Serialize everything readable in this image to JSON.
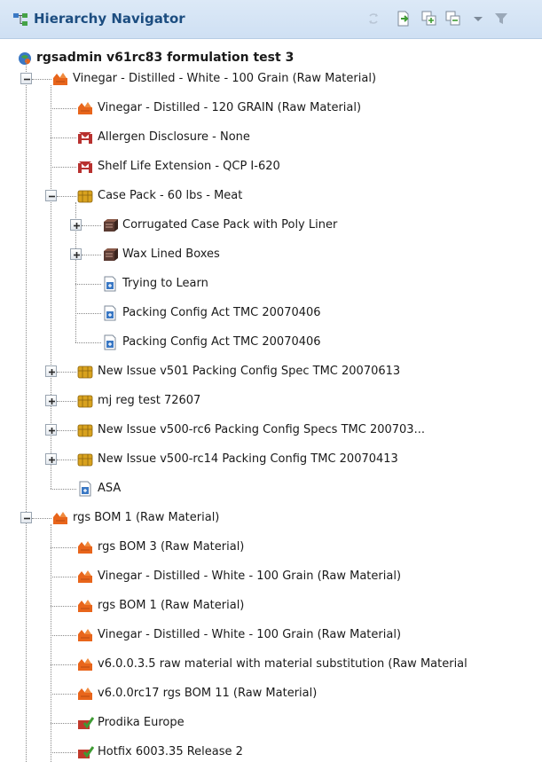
{
  "header": {
    "title": "Hierarchy Navigator",
    "icon": "hierarchy-icon",
    "tools": [
      "refresh-icon",
      "export-icon",
      "expand-all-icon",
      "collapse-all-icon",
      "dropdown-arrow-icon",
      "filter-icon"
    ]
  },
  "tree": {
    "root_label": "rgsadmin v61rc83 formulation test 3",
    "nodes": [
      {
        "label": "Vinegar - Distilled - White - 100 Grain (Raw Material)",
        "icon": "raw-material-icon",
        "toggle": "minus"
      },
      {
        "label": "Vinegar - Distilled - 120 GRAIN (Raw Material)",
        "icon": "raw-material-icon",
        "toggle": ""
      },
      {
        "label": "Allergen Disclosure - None",
        "icon": "spec-red-icon",
        "toggle": ""
      },
      {
        "label": "Shelf Life Extension - QCP I-620",
        "icon": "spec-red-icon",
        "toggle": ""
      },
      {
        "label": "Case Pack - 60 lbs - Meat",
        "icon": "packaging-icon",
        "toggle": "minus"
      },
      {
        "label": "Corrugated Case Pack with Poly Liner",
        "icon": "material-box-icon",
        "toggle": "plus"
      },
      {
        "label": "Wax Lined Boxes",
        "icon": "material-box-icon",
        "toggle": "plus"
      },
      {
        "label": "Trying to Learn",
        "icon": "config-doc-icon",
        "toggle": ""
      },
      {
        "label": "Packing Config Act TMC 20070406",
        "icon": "config-doc-icon",
        "toggle": ""
      },
      {
        "label": "Packing Config Act TMC 20070406",
        "icon": "config-doc-icon",
        "toggle": ""
      },
      {
        "label": "New Issue v501 Packing Config Spec TMC 20070613",
        "icon": "packaging-icon",
        "toggle": "plus"
      },
      {
        "label": "mj reg test 72607",
        "icon": "packaging-icon",
        "toggle": "plus"
      },
      {
        "label": "New Issue v500-rc6 Packing Config Specs TMC 200703...",
        "icon": "packaging-icon",
        "toggle": "plus"
      },
      {
        "label": "New Issue v500-rc14 Packing Config TMC 20070413",
        "icon": "packaging-icon",
        "toggle": "plus"
      },
      {
        "label": "ASA",
        "icon": "config-doc-icon",
        "toggle": ""
      },
      {
        "label": "rgs BOM 1 (Raw Material)",
        "icon": "raw-material-icon",
        "toggle": "minus"
      },
      {
        "label": "rgs BOM 3 (Raw Material)",
        "icon": "raw-material-icon",
        "toggle": ""
      },
      {
        "label": "Vinegar - Distilled - White - 100 Grain (Raw Material)",
        "icon": "raw-material-icon",
        "toggle": ""
      },
      {
        "label": "rgs BOM 1 (Raw Material)",
        "icon": "raw-material-icon",
        "toggle": ""
      },
      {
        "label": "Vinegar - Distilled - White - 100 Grain (Raw Material)",
        "icon": "raw-material-icon",
        "toggle": ""
      },
      {
        "label": "v6.0.0.3.5 raw material with material substitution (Raw Material",
        "icon": "raw-material-icon",
        "toggle": ""
      },
      {
        "label": "v6.0.0rc17 rgs BOM 11 (Raw Material)",
        "icon": "raw-material-icon",
        "toggle": ""
      },
      {
        "label": "Prodika Europe",
        "icon": "approved-item-icon",
        "toggle": ""
      },
      {
        "label": "Hotfix 6003.35 Release 2",
        "icon": "approved-item-icon",
        "toggle": ""
      }
    ]
  },
  "colors": {
    "header_bg": "#cfe0f3",
    "header_text": "#1c4d80",
    "raw_material": "#e8651b",
    "packaging": "#d8a21f",
    "spec_red": "#b8312f",
    "config_doc": "#3a78c4",
    "approved": "#3f9b34"
  }
}
